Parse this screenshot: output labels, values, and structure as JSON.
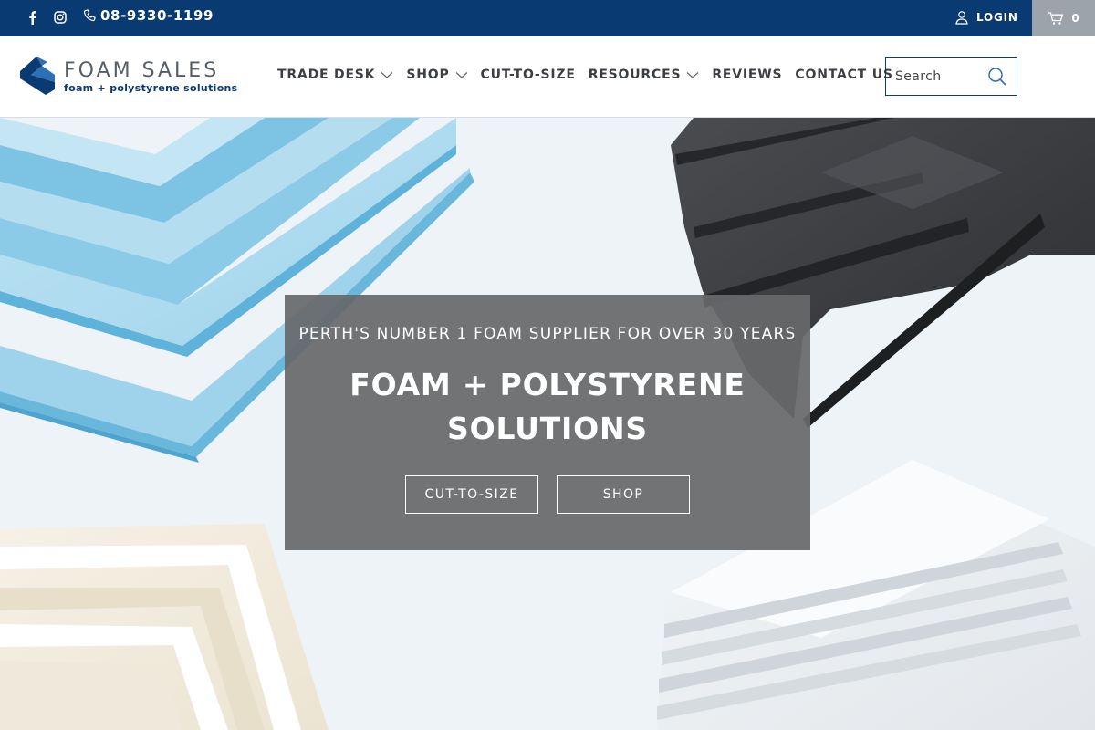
{
  "topbar": {
    "phone": "08-9330-1199",
    "login_label": "LOGIN",
    "cart_count": "0",
    "icons": [
      "facebook-icon",
      "instagram-icon",
      "phone-icon",
      "user-icon",
      "cart-icon"
    ]
  },
  "brand": {
    "name": "FOAM SALES",
    "tagline": "foam + polystyrene solutions",
    "colors": {
      "primary": "#0a3a72",
      "accent": "#2f6fb3"
    }
  },
  "nav": {
    "items": [
      {
        "label": "TRADE DESK",
        "dropdown": true
      },
      {
        "label": "SHOP",
        "dropdown": true
      },
      {
        "label": "CUT-TO-SIZE",
        "dropdown": false
      },
      {
        "label": "RESOURCES",
        "dropdown": true
      },
      {
        "label": "REVIEWS",
        "dropdown": false
      },
      {
        "label": "CONTACT US",
        "dropdown": false
      }
    ]
  },
  "search": {
    "placeholder": "Search"
  },
  "hero": {
    "subtitle": "PERTH'S NUMBER 1 FOAM SUPPLIER FOR OVER 30 YEARS",
    "title_line1": "FOAM + POLYSTYRENE",
    "title_line2": "SOLUTIONS",
    "buttons": [
      "CUT-TO-SIZE",
      "SHOP"
    ]
  }
}
